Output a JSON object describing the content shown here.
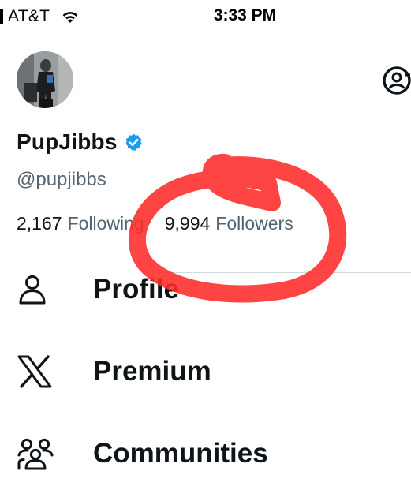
{
  "status_bar": {
    "carrier": "AT&T",
    "time": "3:33 PM",
    "wifi_icon": "wifi-icon"
  },
  "profile": {
    "display_name": "PupJibbs",
    "handle": "@pupjibbs",
    "verified": true,
    "verified_color": "#1d9bf0",
    "following_count": "2,167",
    "following_label": "Following",
    "followers_count": "9,994",
    "followers_label": "Followers"
  },
  "menu": {
    "items": [
      {
        "label": "Profile",
        "icon": "person-icon"
      },
      {
        "label": "Premium",
        "icon": "x-logo-icon"
      },
      {
        "label": "Communities",
        "icon": "communities-icon"
      }
    ]
  },
  "annotation": {
    "type": "hand-drawn-circle",
    "color": "#ff2a2a",
    "target": "followers"
  }
}
